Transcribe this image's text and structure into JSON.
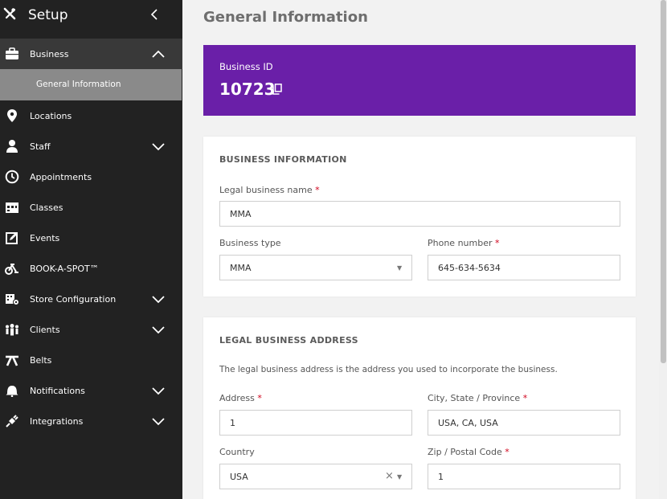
{
  "sidebar": {
    "title": "Setup",
    "items": [
      {
        "label": "Business",
        "icon": "briefcase-icon",
        "expanded": true
      },
      {
        "label": "Locations",
        "icon": "map-pin-icon"
      },
      {
        "label": "Staff",
        "icon": "person-icon",
        "has_chevron": true
      },
      {
        "label": "Appointments",
        "icon": "clock-icon"
      },
      {
        "label": "Classes",
        "icon": "calendar-icon"
      },
      {
        "label": "Events",
        "icon": "edit-icon"
      },
      {
        "label": "BOOK-A-SPOT™",
        "icon": "bike-icon"
      },
      {
        "label": "Store Configuration",
        "icon": "store-icon",
        "has_chevron": true
      },
      {
        "label": "Clients",
        "icon": "group-icon",
        "has_chevron": true
      },
      {
        "label": "Belts",
        "icon": "belt-icon"
      },
      {
        "label": "Notifications",
        "icon": "bell-icon",
        "has_chevron": true
      },
      {
        "label": "Integrations",
        "icon": "plug-icon",
        "has_chevron": true
      }
    ],
    "sub_item": "General Information"
  },
  "main": {
    "title": "General Information",
    "business_id_label": "Business ID",
    "business_id_value": "10723",
    "business_info": {
      "title": "BUSINESS INFORMATION",
      "legal_name_label": "Legal business name",
      "legal_name_value": "MMA",
      "business_type_label": "Business type",
      "business_type_value": "MMA",
      "phone_label": "Phone number",
      "phone_value": "645-634-5634"
    },
    "legal_address": {
      "title": "LEGAL BUSINESS ADDRESS",
      "description": "The legal business address is the address you used to incorporate the business.",
      "address_label": "Address",
      "address_value": "1",
      "city_label": "City, State / Province",
      "city_value": "USA, CA, USA",
      "country_label": "Country",
      "country_value": "USA",
      "zip_label": "Zip / Postal Code",
      "zip_value": "1"
    },
    "required_marker": "*"
  },
  "colors": {
    "sidebar_bg": "#222222",
    "sidebar_active": "#393939",
    "sidebar_sub": "#8a8a8a",
    "accent_purple": "#6a1fa8",
    "required_red": "#d0021b"
  }
}
